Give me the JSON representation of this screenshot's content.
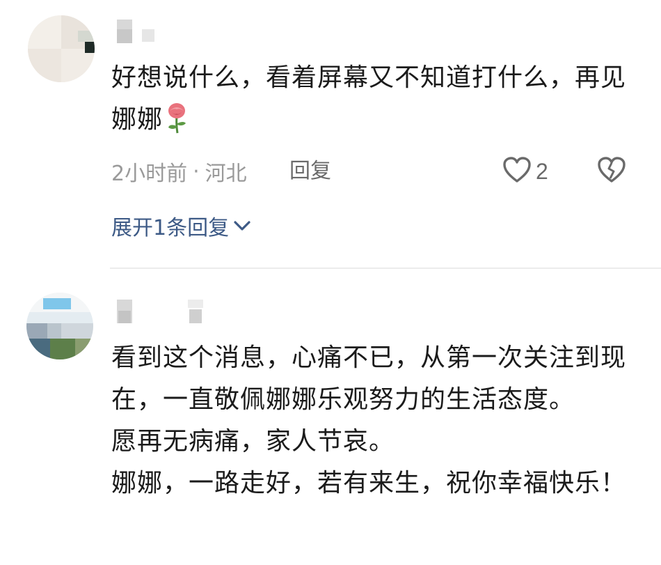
{
  "comments": [
    {
      "text": "好想说什么，看着屏幕又不知道打什么，再见娜娜",
      "emoji": "rose",
      "time": "2小时前",
      "separator": "·",
      "location": "河北",
      "reply_label": "回复",
      "like_count": "2",
      "expand_label": "展开1条回复"
    },
    {
      "text": "看到这个消息，心痛不已，从第一次关注到现在，一直敬佩娜娜乐观努力的生活态度。\n愿再无病痛，家人节哀。\n娜娜，一路走好，若有来生，祝你幸福快乐！"
    }
  ],
  "colors": {
    "text": "#1b1b1b",
    "meta": "#9a9a9a",
    "link": "#3d5a86",
    "icon": "#6a6a6a"
  }
}
